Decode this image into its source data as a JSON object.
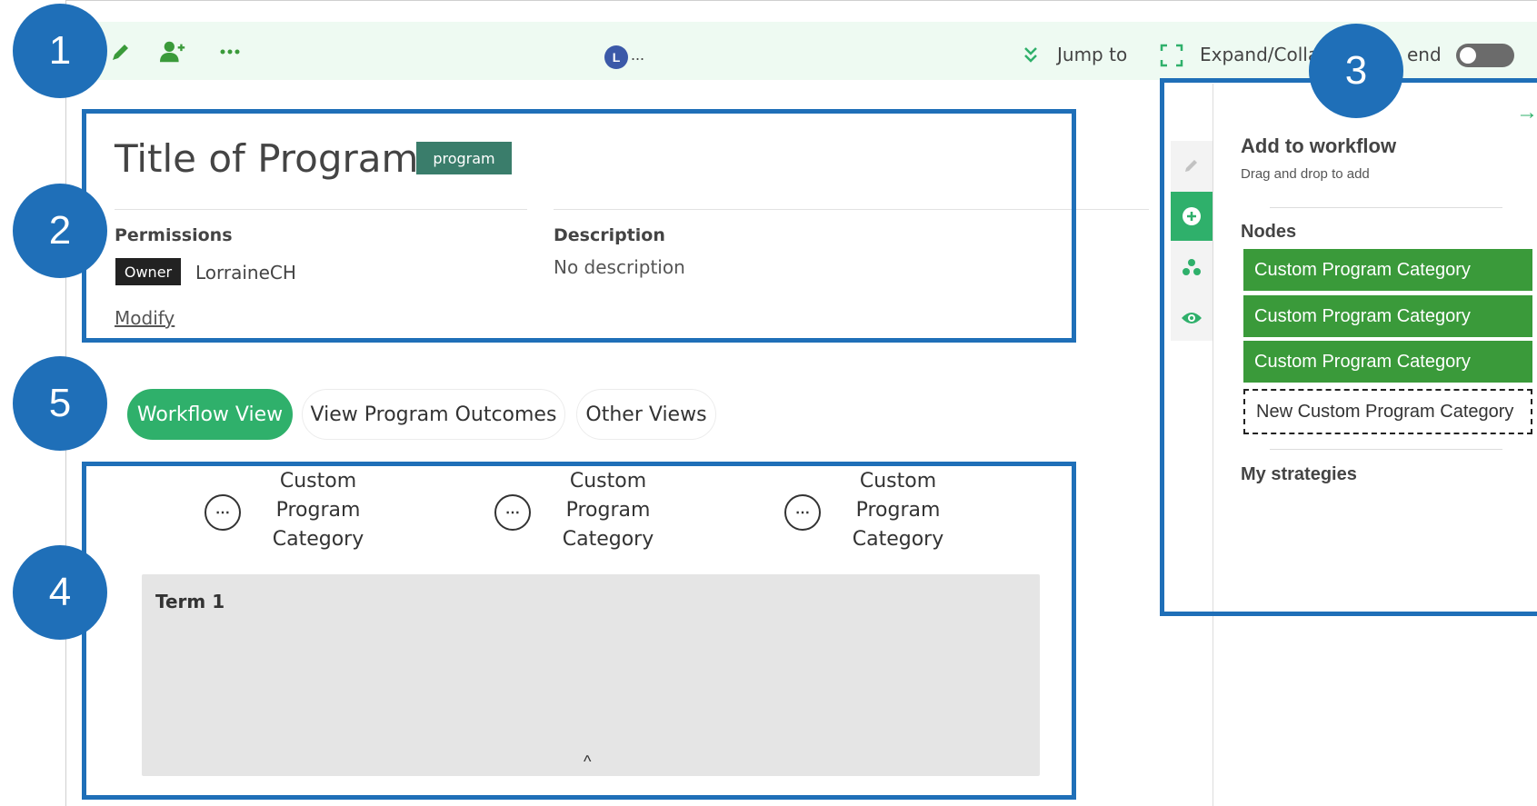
{
  "toolbar": {
    "avatar_initial": "L",
    "avatar_more": "...",
    "jump_to_label": "Jump to",
    "expand_collapse_label": "Expand/Colla",
    "legend_label": "end"
  },
  "callouts": [
    "1",
    "2",
    "3",
    "4",
    "5"
  ],
  "header": {
    "title": "Title of Program",
    "type_badge": "program",
    "permissions_label": "Permissions",
    "owner_tag": "Owner",
    "owner_name": "LorraineCH",
    "modify_link": "Modify",
    "description_label": "Description",
    "description_text": "No description"
  },
  "tabs": [
    {
      "label": "Workflow View",
      "active": true
    },
    {
      "label": "View Program Outcomes",
      "active": false
    },
    {
      "label": "Other Views",
      "active": false
    }
  ],
  "workflow": {
    "columns": [
      {
        "label": "Custom Program Category"
      },
      {
        "label": "Custom Program Category"
      },
      {
        "label": "Custom Program Category"
      }
    ],
    "more_glyph": "⋯",
    "term_label": "Term 1",
    "collapse_glyph": "^"
  },
  "side_panel": {
    "title": "Add to workflow",
    "subtitle": "Drag and drop to add",
    "nodes_label": "Nodes",
    "nodes": [
      "Custom Program Category",
      "Custom Program Category",
      "Custom Program Category"
    ],
    "new_node_label": "New Custom Program Category",
    "strategies_label": "My strategies",
    "close_arrow": "→"
  },
  "colors": {
    "accent_green": "#2fb06b",
    "node_green": "#3a9a3a",
    "callout_blue": "#1f6fb8",
    "toolbar_bg": "#eefaf2"
  },
  "icons": [
    "edit-icon",
    "add-user-icon",
    "more-icon",
    "jump-to-icon",
    "expand-icon",
    "side-edit-icon",
    "side-add-icon",
    "side-outcomes-icon",
    "side-view-icon"
  ]
}
